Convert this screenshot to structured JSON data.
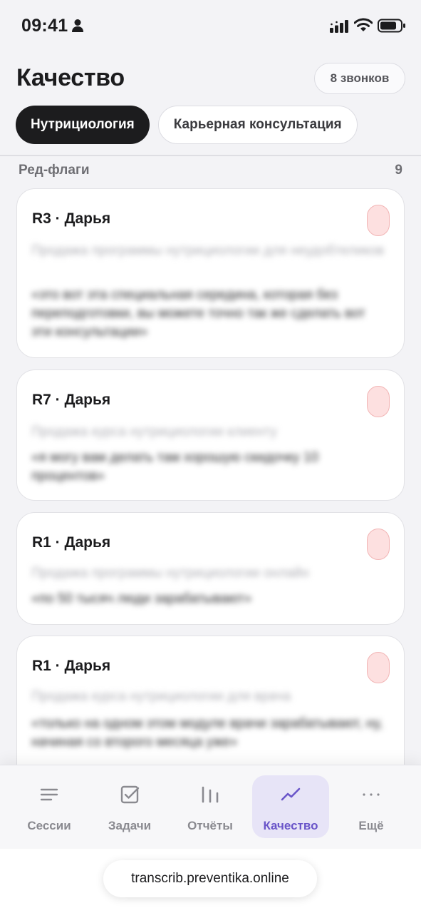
{
  "status_bar": {
    "time": "09:41",
    "icons": [
      "person-icon",
      "signal-icon",
      "wifi-icon",
      "battery-icon"
    ]
  },
  "header": {
    "title": "Качество",
    "calls_badge": "8 звонков"
  },
  "tabs": [
    {
      "label": "Нутрициология",
      "active": true
    },
    {
      "label": "Карьерная консультация",
      "active": false
    }
  ],
  "section": {
    "title": "Ред-флаги",
    "count": "9"
  },
  "cards": [
    {
      "title": "R3 · Дарья",
      "subtitle": "Продажа программы нутрициологии для неудобтеликов",
      "quote": "«это вот эта специальная середина, которая без переподготовки, вы можете точно так же сделать вот эти консультации»"
    },
    {
      "title": "R7 · Дарья",
      "subtitle": "Продажа курса нутрициологии клиенту",
      "quote": "«я могу вам делать там хорошую скидочку 10 процентов»"
    },
    {
      "title": "R1 · Дарья",
      "subtitle": "Продажа программы нутрициологии онлайн",
      "quote": "«по 50 тысяч люди зарабатывают»"
    },
    {
      "title": "R1 · Дарья",
      "subtitle": "Продажа курса нутрициологии для врача",
      "quote": "«только на одном этом модуле врачи зарабатывают, ну, начиная со второго месяца уже»"
    }
  ],
  "nav": [
    {
      "label": "Сессии",
      "icon": "menu-lines-icon",
      "active": false
    },
    {
      "label": "Задачи",
      "icon": "checkbox-icon",
      "active": false
    },
    {
      "label": "Отчёты",
      "icon": "bar-chart-icon",
      "active": false
    },
    {
      "label": "Качество",
      "icon": "trend-line-icon",
      "active": true
    },
    {
      "label": "Ещё",
      "icon": "more-dots-icon",
      "active": false
    }
  ],
  "browser": {
    "url": "transcrib.preventika.online"
  },
  "colors": {
    "accent": "#6a55c9",
    "active_tab_bg": "#1c1c1e",
    "flag_fill": "#fde0e0",
    "nav_active_bg": "#e7e4f7"
  }
}
